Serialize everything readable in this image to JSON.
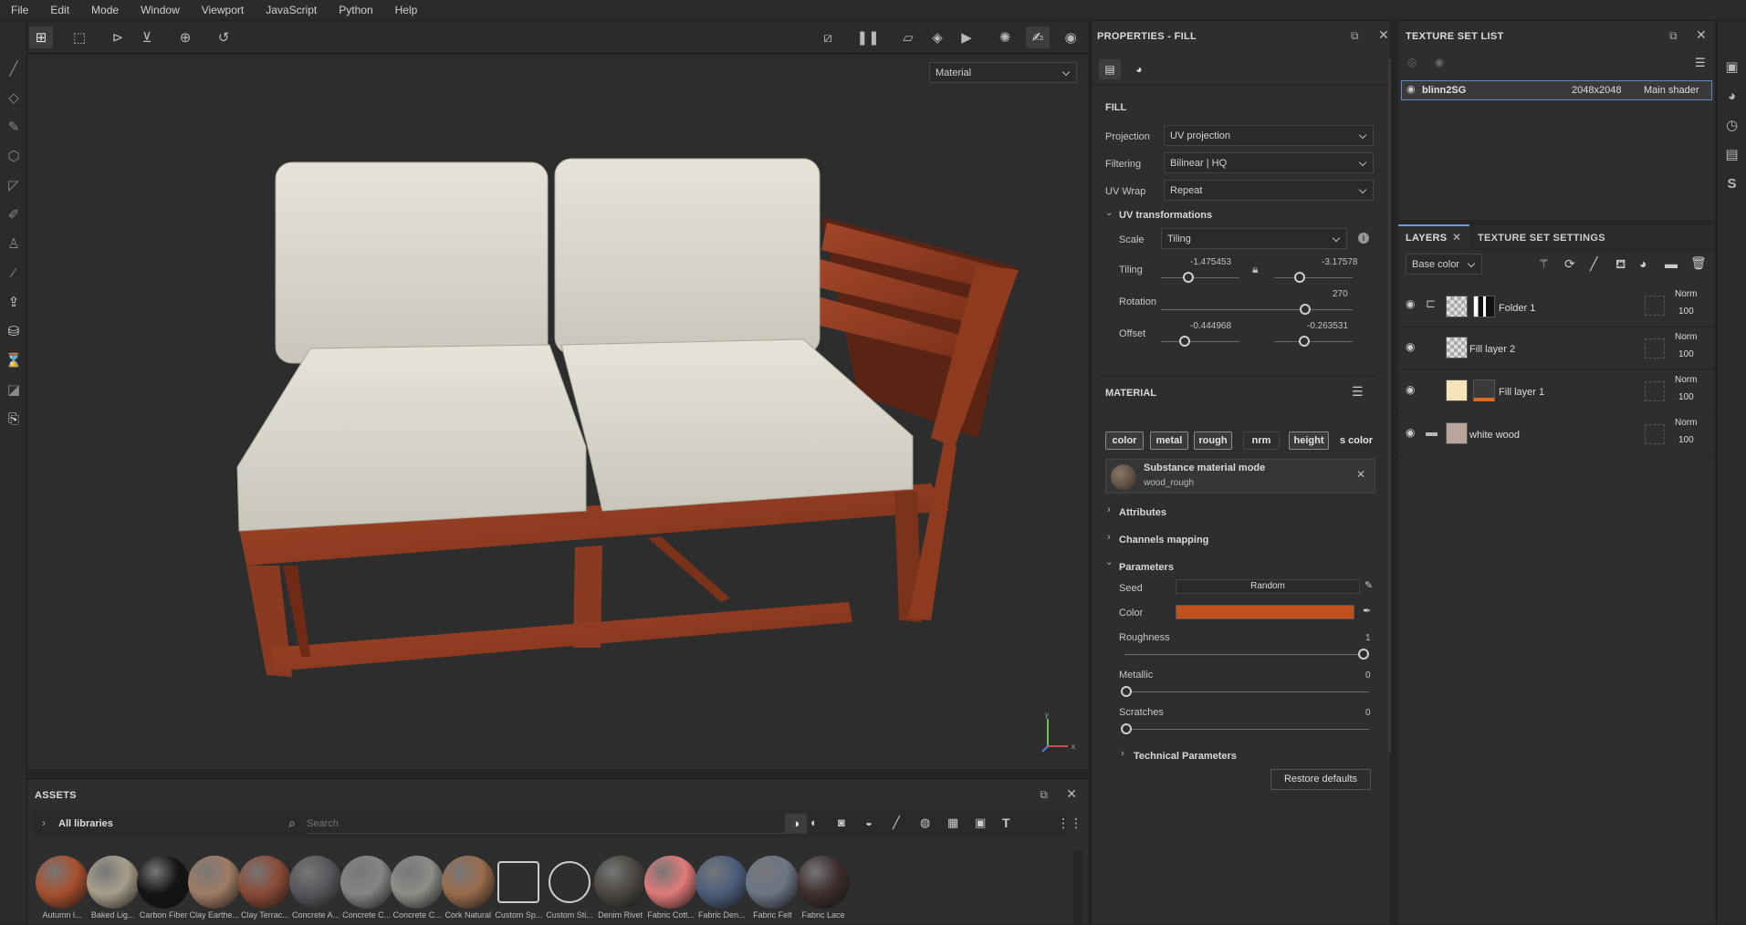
{
  "menu": [
    "File",
    "Edit",
    "Mode",
    "Window",
    "Viewport",
    "JavaScript",
    "Python",
    "Help"
  ],
  "viewport": {
    "mode_select": "Material",
    "axis_y": "y",
    "axis_x": "x"
  },
  "properties": {
    "panel_title": "PROPERTIES - FILL",
    "fill_header": "FILL",
    "projection_label": "Projection",
    "projection_value": "UV projection",
    "filtering_label": "Filtering",
    "filtering_value": "Bilinear | HQ",
    "uvwrap_label": "UV Wrap",
    "uvwrap_value": "Repeat",
    "uvtrans_header": "UV transformations",
    "scale_label": "Scale",
    "scale_value": "Tiling",
    "tiling_label": "Tiling",
    "tiling_value_1": "-1.475453",
    "tiling_value_2": "-3.17578",
    "tiling_level_1": 0.35,
    "tiling_level_2": 0.33,
    "rotation_label": "Rotation",
    "rotation_value": "270",
    "rotation_level": 0.75,
    "offset_label": "Offset",
    "offset_value_1": "-0.444968",
    "offset_value_2": "-0.263531",
    "offset_level_1": 0.3,
    "offset_level_2": 0.38,
    "material_header": "MATERIAL",
    "channels": [
      "color",
      "metal",
      "rough",
      "nrm",
      "height",
      "s color"
    ],
    "substance_title": "Substance material mode",
    "substance_name": "wood_rough",
    "attributes_header": "Attributes",
    "channels_mapping_header": "Channels mapping",
    "parameters_header": "Parameters",
    "seed_label": "Seed",
    "seed_value": "Random",
    "color_label": "Color",
    "color_hex": "#c0501e",
    "roughness_label": "Roughness",
    "roughness_value": "1",
    "metallic_label": "Metallic",
    "metallic_value": "0",
    "scratches_label": "Scratches",
    "scratches_value": "0",
    "technical_header": "Technical Parameters",
    "restore_button": "Restore defaults"
  },
  "texture_set_list": {
    "title": "TEXTURE SET LIST",
    "item_name": "blinn2SG",
    "item_res": "2048x2048",
    "item_shader": "Main shader"
  },
  "layers": {
    "tab_layers": "LAYERS",
    "tab_tss": "TEXTURE SET SETTINGS",
    "channel_select": "Base color",
    "rows": [
      {
        "name": "Folder 1",
        "blend": "Norm",
        "opacity": "100"
      },
      {
        "name": "Fill layer 2",
        "blend": "Norm",
        "opacity": "100"
      },
      {
        "name": "Fill layer 1",
        "blend": "Norm",
        "opacity": "100"
      },
      {
        "name": "white wood",
        "blend": "Norm",
        "opacity": "100"
      }
    ]
  },
  "assets": {
    "title": "ASSETS",
    "libraries": "All libraries",
    "search_placeholder": "Search",
    "items": [
      {
        "label": "Autumn l...",
        "color": "#a8502e"
      },
      {
        "label": "Baked Lig...",
        "color": "#a89e8c"
      },
      {
        "label": "Carbon Fiber",
        "color": "#141414"
      },
      {
        "label": "Clay Earthe...",
        "color": "#a07c64"
      },
      {
        "label": "Clay Terrac...",
        "color": "#8a4a36"
      },
      {
        "label": "Concrete A...",
        "color": "#55565a"
      },
      {
        "label": "Concrete C...",
        "color": "#858585"
      },
      {
        "label": "Concrete C...",
        "color": "#8c8e88"
      },
      {
        "label": "Cork Natural",
        "color": "#9a6c4c"
      },
      {
        "label": "Custom Sp...",
        "color": "#2e2e2e"
      },
      {
        "label": "Custom Sti...",
        "color": "#2e2e2e"
      },
      {
        "label": "Denim Rivet",
        "color": "#4a4640"
      },
      {
        "label": "Fabric Cott...",
        "color": "#e07a78"
      },
      {
        "label": "Fabric Den...",
        "color": "#4c5e7c"
      },
      {
        "label": "Fabric Felt",
        "color": "#6c7686"
      },
      {
        "label": "Fabric Lace",
        "color": "#3e2e2e"
      }
    ]
  }
}
